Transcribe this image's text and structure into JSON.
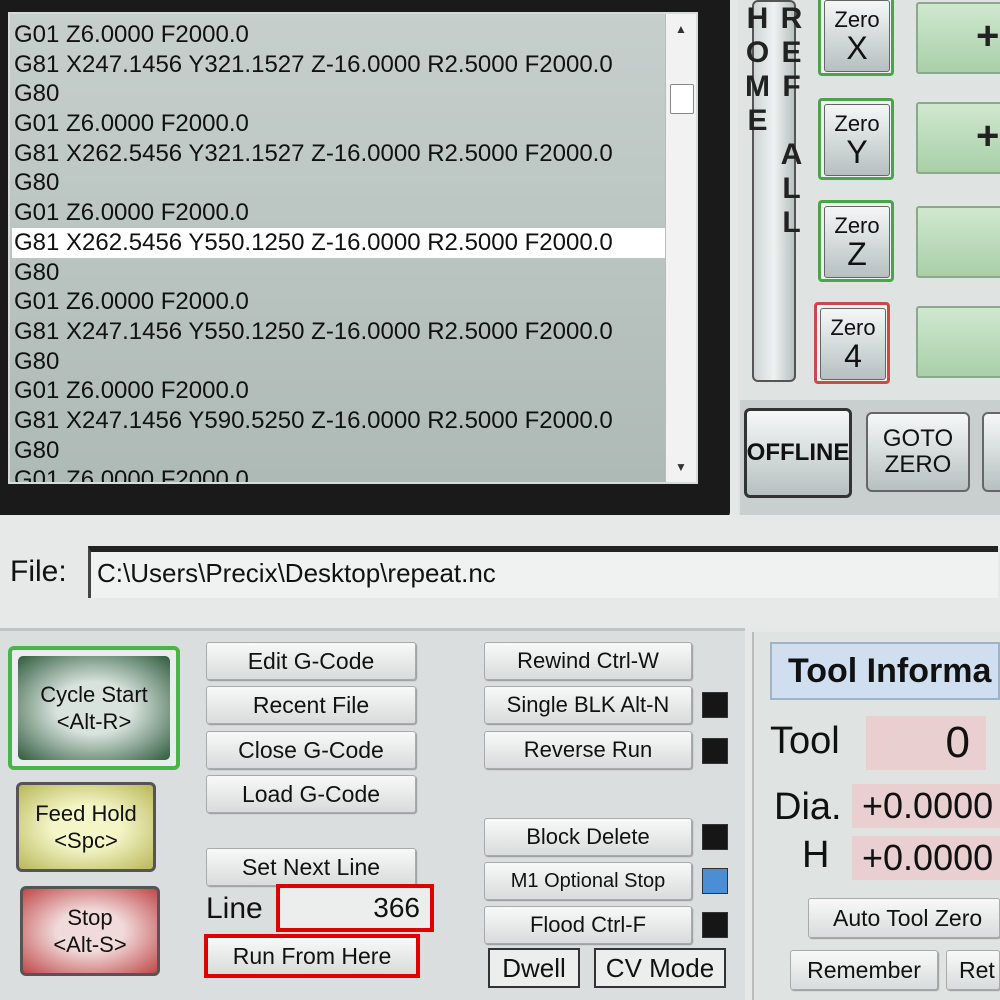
{
  "gcode": {
    "lines": [
      "G01 Z6.0000  F2000.0",
      "G81 X247.1456 Y321.1527 Z-16.0000 R2.5000 F2000.0",
      "G80",
      "G01 Z6.0000  F2000.0",
      "G81 X262.5456 Y321.1527 Z-16.0000 R2.5000 F2000.0",
      "G80",
      "G01 Z6.0000  F2000.0",
      "G81 X262.5456 Y550.1250 Z-16.0000 R2.5000 F2000.0",
      "G80",
      "G01 Z6.0000  F2000.0",
      "G81 X247.1456 Y550.1250 Z-16.0000 R2.5000 F2000.0",
      "G80",
      "G01 Z6.0000  F2000.0",
      "G81 X247.1456 Y590.5250 Z-16.0000 R2.5000 F2000.0",
      "G80",
      "G01 Z6.0000  F2000.0"
    ],
    "highlighted_index": 7
  },
  "axis_panel": {
    "ref_all_home": "REF ALL HOME",
    "zero_buttons": [
      {
        "top": "Zero",
        "axis": "X"
      },
      {
        "top": "Zero",
        "axis": "Y"
      },
      {
        "top": "Zero",
        "axis": "Z"
      },
      {
        "top": "Zero",
        "axis": "4"
      }
    ],
    "green_symbol": "+",
    "offline": "OFFLINE",
    "goto_zero_1": "GOTO",
    "goto_zero_2": "ZERO"
  },
  "file": {
    "label": "File:",
    "path": "C:\\Users\\Precix\\Desktop\\repeat.nc"
  },
  "controls": {
    "cycle_start_1": "Cycle Start",
    "cycle_start_2": "<Alt-R>",
    "feed_hold_1": "Feed Hold",
    "feed_hold_2": "<Spc>",
    "stop_1": "Stop",
    "stop_2": "<Alt-S>",
    "edit_gcode": "Edit G-Code",
    "recent_file": "Recent File",
    "close_gcode": "Close G-Code",
    "load_gcode": "Load G-Code",
    "set_next_line": "Set Next Line",
    "line_label": "Line",
    "line_value": "366",
    "run_from_here": "Run From Here",
    "rewind": "Rewind Ctrl-W",
    "single_blk": "Single BLK Alt-N",
    "reverse_run": "Reverse Run",
    "block_delete": "Block Delete",
    "m1_optional_stop": "M1 Optional Stop",
    "flood": "Flood Ctrl-F",
    "dwell": "Dwell",
    "cv_mode": "CV Mode"
  },
  "tool_info": {
    "header": "Tool Informa",
    "tool_label": "Tool",
    "tool_value": "0",
    "dia_label": "Dia.",
    "dia_value": "+0.0000",
    "h_label": "H",
    "h_value": "+0.0000",
    "auto_tool_zero": "Auto Tool Zero",
    "remember": "Remember",
    "return_partial": "Ret"
  },
  "colors": {
    "highlight_box": "#e00000",
    "led_active": "#4a8fd6",
    "cycle_start_border": "#3aa53a"
  }
}
